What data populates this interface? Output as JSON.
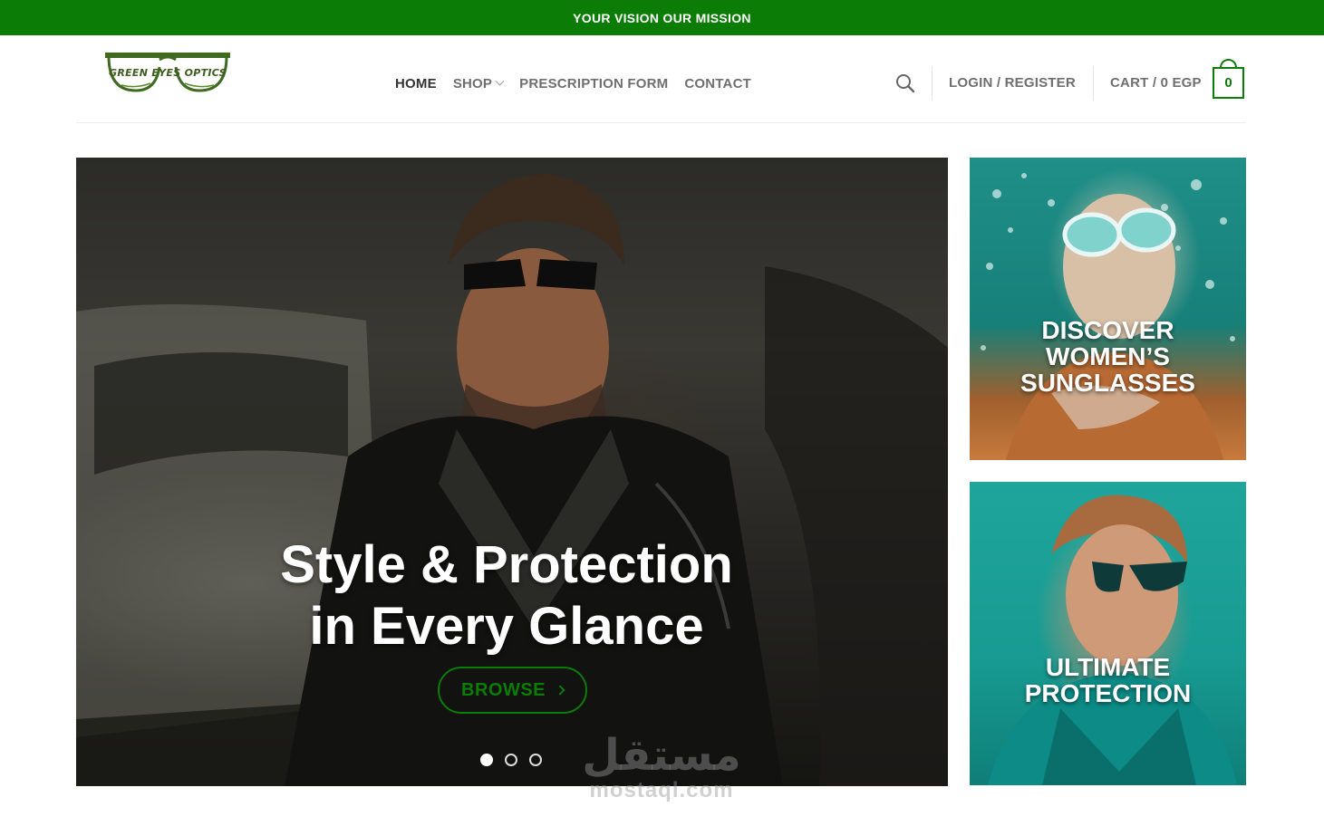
{
  "topbar": {
    "text": "YOUR VISION OUR MISSION"
  },
  "brand": {
    "name": "GREEN EYES OPTICS",
    "color": "#0b7d06"
  },
  "nav": {
    "items": [
      {
        "label": "HOME",
        "active": true
      },
      {
        "label": "SHOP",
        "has_dropdown": true
      },
      {
        "label": "PRESCRIPTION FORM"
      },
      {
        "label": "CONTACT"
      }
    ]
  },
  "header": {
    "search_icon": "search-icon",
    "login_label": "LOGIN / REGISTER",
    "cart_label": "CART / 0 EGP",
    "cart_count": "0"
  },
  "hero": {
    "title_line1": "Style & Protection",
    "title_line2": "in Every Glance",
    "button_label": "BROWSE",
    "slides": 3,
    "active_slide": 1
  },
  "promos": [
    {
      "title_line1": "DISCOVER",
      "title_line2": "WOMEN’S",
      "title_line3": "SUNGLASSES"
    },
    {
      "title_line1": "ULTIMATE",
      "title_line2": "PROTECTION"
    }
  ],
  "watermark": {
    "arabic": "مستقل",
    "latin": "mostaql.com"
  }
}
